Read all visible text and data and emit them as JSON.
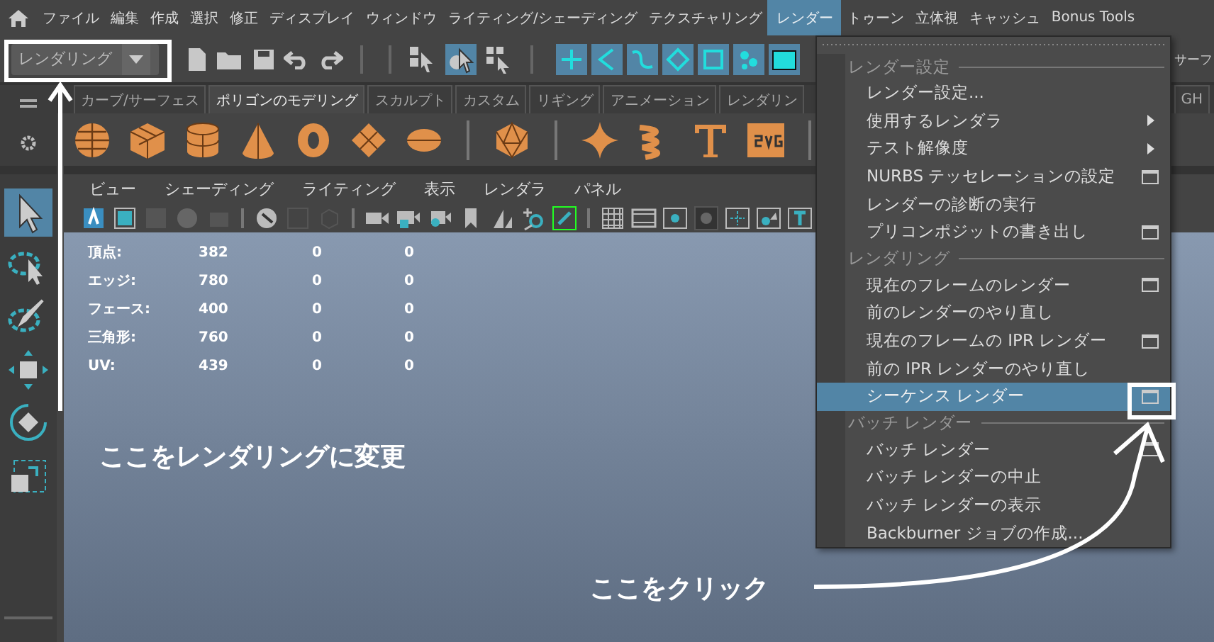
{
  "menubar": {
    "items": [
      {
        "label": "ファイル",
        "selected": false
      },
      {
        "label": "編集",
        "selected": false
      },
      {
        "label": "作成",
        "selected": false
      },
      {
        "label": "選択",
        "selected": false
      },
      {
        "label": "修正",
        "selected": false
      },
      {
        "label": "ディスプレイ",
        "selected": false
      },
      {
        "label": "ウィンドウ",
        "selected": false
      },
      {
        "label": "ライティング/シェーディング",
        "selected": false
      },
      {
        "label": "テクスチャリング",
        "selected": false
      },
      {
        "label": "レンダー",
        "selected": true
      },
      {
        "label": "トゥーン",
        "selected": false
      },
      {
        "label": "立体視",
        "selected": false
      },
      {
        "label": "キャッシュ",
        "selected": false
      },
      {
        "label": "Bonus Tools",
        "selected": false
      }
    ]
  },
  "toolbar": {
    "mode_dropdown": {
      "value": "レンダリング"
    },
    "right_label": "サーフ"
  },
  "shelf": {
    "tabs": [
      {
        "label": "カーブ/サーフェス",
        "selected": false
      },
      {
        "label": "ポリゴンのモデリング",
        "selected": true
      },
      {
        "label": "スカルプト",
        "selected": false
      },
      {
        "label": "カスタム",
        "selected": false
      },
      {
        "label": "リギング",
        "selected": false
      },
      {
        "label": "アニメーション",
        "selected": false
      },
      {
        "label": "レンダリン",
        "selected": false
      },
      {
        "label": "GH",
        "selected": false
      }
    ]
  },
  "toolbox": {
    "tools": [
      {
        "kind": "select",
        "selected": true
      },
      {
        "kind": "lasso",
        "selected": false
      },
      {
        "kind": "paint",
        "selected": false
      },
      {
        "kind": "move",
        "selected": false
      },
      {
        "kind": "rotate",
        "selected": false
      },
      {
        "kind": "scale",
        "selected": false
      }
    ]
  },
  "viewport": {
    "menu": [
      "ビュー",
      "シェーディング",
      "ライティング",
      "表示",
      "レンダラ",
      "パネル"
    ],
    "hud": [
      {
        "label": "頂点:",
        "values": [
          "382",
          "0",
          "0"
        ]
      },
      {
        "label": "エッジ:",
        "values": [
          "780",
          "0",
          "0"
        ]
      },
      {
        "label": "フェース:",
        "values": [
          "400",
          "0",
          "0"
        ]
      },
      {
        "label": "三角形:",
        "values": [
          "760",
          "0",
          "0"
        ]
      },
      {
        "label": "UV:",
        "values": [
          "439",
          "0",
          "0"
        ]
      }
    ]
  },
  "render_menu": {
    "sections": [
      {
        "title": "レンダー設定",
        "items": [
          {
            "label": "レンダー設定...",
            "kind": "plain",
            "selected": false
          },
          {
            "label": "使用するレンダラ",
            "kind": "submenu",
            "selected": false
          },
          {
            "label": "テスト解像度",
            "kind": "submenu",
            "selected": false
          },
          {
            "label": "NURBS テッセレーションの設定",
            "kind": "option",
            "selected": false
          },
          {
            "label": "レンダーの診断の実行",
            "kind": "plain",
            "selected": false
          },
          {
            "label": "プリコンポジットの書き出し",
            "kind": "option",
            "selected": false
          }
        ]
      },
      {
        "title": "レンダリング",
        "items": [
          {
            "label": "現在のフレームのレンダー",
            "kind": "option",
            "selected": false
          },
          {
            "label": "前のレンダーのやり直し",
            "kind": "plain",
            "selected": false
          },
          {
            "label": "現在のフレームの IPR レンダー",
            "kind": "option",
            "selected": false
          },
          {
            "label": "前の IPR レンダーのやり直し",
            "kind": "plain",
            "selected": false
          },
          {
            "label": "シーケンス レンダー",
            "kind": "option",
            "selected": true
          }
        ]
      },
      {
        "title": "バッチ レンダー",
        "items": [
          {
            "label": "バッチ レンダー",
            "kind": "option",
            "selected": false
          },
          {
            "label": "バッチ レンダーの中止",
            "kind": "plain",
            "selected": false
          },
          {
            "label": "バッチ レンダーの表示",
            "kind": "plain",
            "selected": false
          },
          {
            "label": "Backburner ジョブの作成...",
            "kind": "plain",
            "selected": false
          }
        ]
      }
    ]
  },
  "annotations": [
    {
      "text": "ここをレンダリングに変更"
    },
    {
      "text": "ここをクリック"
    }
  ]
}
